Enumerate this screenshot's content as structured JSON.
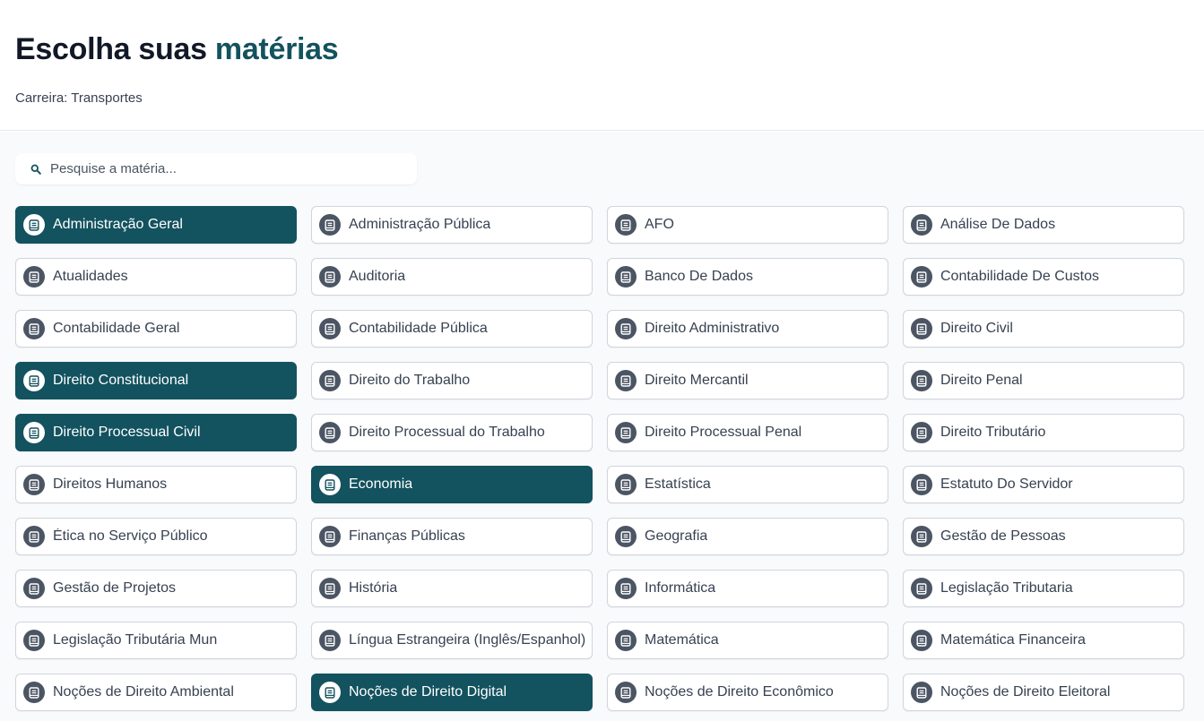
{
  "header": {
    "title_main": "Escolha suas ",
    "title_accent": "matérias",
    "subtitle": "Carreira: Transportes"
  },
  "search": {
    "placeholder": "Pesquise a matéria...",
    "value": ""
  },
  "colors": {
    "accent": "#13525f",
    "icon_badge": "#4b5563"
  },
  "subjects": [
    {
      "label": "Administração Geral",
      "selected": true
    },
    {
      "label": "Administração Pública",
      "selected": false
    },
    {
      "label": "AFO",
      "selected": false
    },
    {
      "label": "Análise De Dados",
      "selected": false
    },
    {
      "label": "Atualidades",
      "selected": false
    },
    {
      "label": "Auditoria",
      "selected": false
    },
    {
      "label": "Banco De Dados",
      "selected": false
    },
    {
      "label": "Contabilidade De Custos",
      "selected": false
    },
    {
      "label": "Contabilidade Geral",
      "selected": false
    },
    {
      "label": "Contabilidade Pública",
      "selected": false
    },
    {
      "label": "Direito Administrativo",
      "selected": false
    },
    {
      "label": "Direito Civil",
      "selected": false
    },
    {
      "label": "Direito Constitucional",
      "selected": true
    },
    {
      "label": "Direito do Trabalho",
      "selected": false
    },
    {
      "label": "Direito Mercantil",
      "selected": false
    },
    {
      "label": "Direito Penal",
      "selected": false
    },
    {
      "label": "Direito Processual Civil",
      "selected": true
    },
    {
      "label": "Direito Processual do Trabalho",
      "selected": false
    },
    {
      "label": "Direito Processual Penal",
      "selected": false
    },
    {
      "label": "Direito Tributário",
      "selected": false
    },
    {
      "label": "Direitos Humanos",
      "selected": false
    },
    {
      "label": "Economia",
      "selected": true
    },
    {
      "label": "Estatística",
      "selected": false
    },
    {
      "label": "Estatuto Do Servidor",
      "selected": false
    },
    {
      "label": "Ética no Serviço Público",
      "selected": false
    },
    {
      "label": "Finanças Públicas",
      "selected": false
    },
    {
      "label": "Geografia",
      "selected": false
    },
    {
      "label": "Gestão de Pessoas",
      "selected": false
    },
    {
      "label": "Gestão de Projetos",
      "selected": false
    },
    {
      "label": "História",
      "selected": false
    },
    {
      "label": "Informática",
      "selected": false
    },
    {
      "label": "Legislação Tributaria",
      "selected": false
    },
    {
      "label": "Legislação Tributária Mun",
      "selected": false
    },
    {
      "label": "Língua Estrangeira (Inglês/Espanhol)",
      "selected": false
    },
    {
      "label": "Matemática",
      "selected": false
    },
    {
      "label": "Matemática Financeira",
      "selected": false
    },
    {
      "label": "Noções de Direito Ambiental",
      "selected": false
    },
    {
      "label": "Noções de Direito Digital",
      "selected": true
    },
    {
      "label": "Noções de Direito Econômico",
      "selected": false
    },
    {
      "label": "Noções de Direito Eleitoral",
      "selected": false
    }
  ],
  "subject_icon": "book-icon"
}
